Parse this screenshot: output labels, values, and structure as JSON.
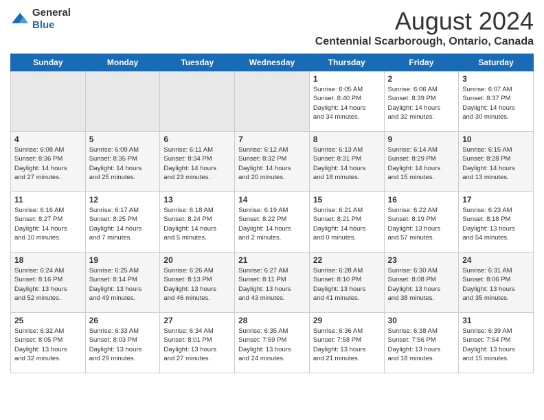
{
  "logo": {
    "general": "General",
    "blue": "Blue"
  },
  "title": "August 2024",
  "subtitle": "Centennial Scarborough, Ontario, Canada",
  "days_of_week": [
    "Sunday",
    "Monday",
    "Tuesday",
    "Wednesday",
    "Thursday",
    "Friday",
    "Saturday"
  ],
  "weeks": [
    [
      {
        "day": "",
        "info": ""
      },
      {
        "day": "",
        "info": ""
      },
      {
        "day": "",
        "info": ""
      },
      {
        "day": "",
        "info": ""
      },
      {
        "day": "1",
        "info": "Sunrise: 6:05 AM\nSunset: 8:40 PM\nDaylight: 14 hours\nand 34 minutes."
      },
      {
        "day": "2",
        "info": "Sunrise: 6:06 AM\nSunset: 8:39 PM\nDaylight: 14 hours\nand 32 minutes."
      },
      {
        "day": "3",
        "info": "Sunrise: 6:07 AM\nSunset: 8:37 PM\nDaylight: 14 hours\nand 30 minutes."
      }
    ],
    [
      {
        "day": "4",
        "info": "Sunrise: 6:08 AM\nSunset: 8:36 PM\nDaylight: 14 hours\nand 27 minutes."
      },
      {
        "day": "5",
        "info": "Sunrise: 6:09 AM\nSunset: 8:35 PM\nDaylight: 14 hours\nand 25 minutes."
      },
      {
        "day": "6",
        "info": "Sunrise: 6:11 AM\nSunset: 8:34 PM\nDaylight: 14 hours\nand 23 minutes."
      },
      {
        "day": "7",
        "info": "Sunrise: 6:12 AM\nSunset: 8:32 PM\nDaylight: 14 hours\nand 20 minutes."
      },
      {
        "day": "8",
        "info": "Sunrise: 6:13 AM\nSunset: 8:31 PM\nDaylight: 14 hours\nand 18 minutes."
      },
      {
        "day": "9",
        "info": "Sunrise: 6:14 AM\nSunset: 8:29 PM\nDaylight: 14 hours\nand 15 minutes."
      },
      {
        "day": "10",
        "info": "Sunrise: 6:15 AM\nSunset: 8:28 PM\nDaylight: 14 hours\nand 13 minutes."
      }
    ],
    [
      {
        "day": "11",
        "info": "Sunrise: 6:16 AM\nSunset: 8:27 PM\nDaylight: 14 hours\nand 10 minutes."
      },
      {
        "day": "12",
        "info": "Sunrise: 6:17 AM\nSunset: 8:25 PM\nDaylight: 14 hours\nand 7 minutes."
      },
      {
        "day": "13",
        "info": "Sunrise: 6:18 AM\nSunset: 8:24 PM\nDaylight: 14 hours\nand 5 minutes."
      },
      {
        "day": "14",
        "info": "Sunrise: 6:19 AM\nSunset: 8:22 PM\nDaylight: 14 hours\nand 2 minutes."
      },
      {
        "day": "15",
        "info": "Sunrise: 6:21 AM\nSunset: 8:21 PM\nDaylight: 14 hours\nand 0 minutes."
      },
      {
        "day": "16",
        "info": "Sunrise: 6:22 AM\nSunset: 8:19 PM\nDaylight: 13 hours\nand 57 minutes."
      },
      {
        "day": "17",
        "info": "Sunrise: 6:23 AM\nSunset: 8:18 PM\nDaylight: 13 hours\nand 54 minutes."
      }
    ],
    [
      {
        "day": "18",
        "info": "Sunrise: 6:24 AM\nSunset: 8:16 PM\nDaylight: 13 hours\nand 52 minutes."
      },
      {
        "day": "19",
        "info": "Sunrise: 6:25 AM\nSunset: 8:14 PM\nDaylight: 13 hours\nand 49 minutes."
      },
      {
        "day": "20",
        "info": "Sunrise: 6:26 AM\nSunset: 8:13 PM\nDaylight: 13 hours\nand 46 minutes."
      },
      {
        "day": "21",
        "info": "Sunrise: 6:27 AM\nSunset: 8:11 PM\nDaylight: 13 hours\nand 43 minutes."
      },
      {
        "day": "22",
        "info": "Sunrise: 6:28 AM\nSunset: 8:10 PM\nDaylight: 13 hours\nand 41 minutes."
      },
      {
        "day": "23",
        "info": "Sunrise: 6:30 AM\nSunset: 8:08 PM\nDaylight: 13 hours\nand 38 minutes."
      },
      {
        "day": "24",
        "info": "Sunrise: 6:31 AM\nSunset: 8:06 PM\nDaylight: 13 hours\nand 35 minutes."
      }
    ],
    [
      {
        "day": "25",
        "info": "Sunrise: 6:32 AM\nSunset: 8:05 PM\nDaylight: 13 hours\nand 32 minutes."
      },
      {
        "day": "26",
        "info": "Sunrise: 6:33 AM\nSunset: 8:03 PM\nDaylight: 13 hours\nand 29 minutes."
      },
      {
        "day": "27",
        "info": "Sunrise: 6:34 AM\nSunset: 8:01 PM\nDaylight: 13 hours\nand 27 minutes."
      },
      {
        "day": "28",
        "info": "Sunrise: 6:35 AM\nSunset: 7:59 PM\nDaylight: 13 hours\nand 24 minutes."
      },
      {
        "day": "29",
        "info": "Sunrise: 6:36 AM\nSunset: 7:58 PM\nDaylight: 13 hours\nand 21 minutes."
      },
      {
        "day": "30",
        "info": "Sunrise: 6:38 AM\nSunset: 7:56 PM\nDaylight: 13 hours\nand 18 minutes."
      },
      {
        "day": "31",
        "info": "Sunrise: 6:39 AM\nSunset: 7:54 PM\nDaylight: 13 hours\nand 15 minutes."
      }
    ]
  ]
}
